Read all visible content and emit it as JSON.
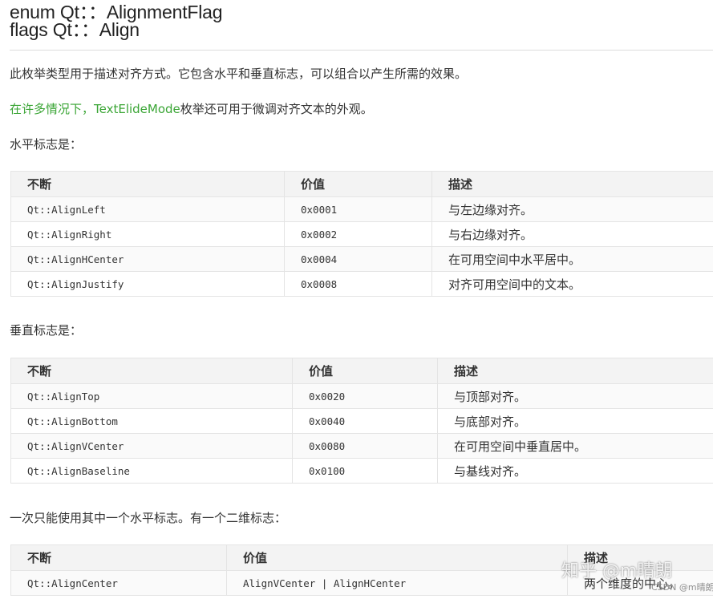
{
  "header": {
    "title_line1": "enum Qt：：AlignmentFlag",
    "title_line2": "flags Qt：：Align"
  },
  "intro": "此枚举类型用于描述对齐方式。它包含水平和垂直标志，可以组合以产生所需的效果。",
  "note": {
    "prefix": "在许多情况下，",
    "link": "TextElideMode",
    "suffix": "枚举还可用于微调对齐文本的外观。"
  },
  "horizontal": {
    "caption": "水平标志是：",
    "headers": [
      "不断",
      "价值",
      "描述"
    ],
    "rows": [
      [
        "Qt::AlignLeft",
        "0x0001",
        "与左边缘对齐。"
      ],
      [
        "Qt::AlignRight",
        "0x0002",
        "与右边缘对齐。"
      ],
      [
        "Qt::AlignHCenter",
        "0x0004",
        "在可用空间中水平居中。"
      ],
      [
        "Qt::AlignJustify",
        "0x0008",
        "对齐可用空间中的文本。"
      ]
    ]
  },
  "vertical": {
    "caption": "垂直标志是：",
    "headers": [
      "不断",
      "价值",
      "描述"
    ],
    "rows": [
      [
        "Qt::AlignTop",
        "0x0020",
        "与顶部对齐。"
      ],
      [
        "Qt::AlignBottom",
        "0x0040",
        "与底部对齐。"
      ],
      [
        "Qt::AlignVCenter",
        "0x0080",
        "在可用空间中垂直居中。"
      ],
      [
        "Qt::AlignBaseline",
        "0x0100",
        "与基线对齐。"
      ]
    ]
  },
  "two_d": {
    "caption": "一次只能使用其中一个水平标志。有一个二维标志：",
    "headers": [
      "不断",
      "价值",
      "描述"
    ],
    "rows": [
      [
        "Qt::AlignCenter",
        "AlignVCenter | AlignHCenter",
        "两个维度的中心。"
      ]
    ]
  },
  "watermark": {
    "main": "知乎 @m晴朗",
    "sub": "CSDN @m晴朗"
  }
}
